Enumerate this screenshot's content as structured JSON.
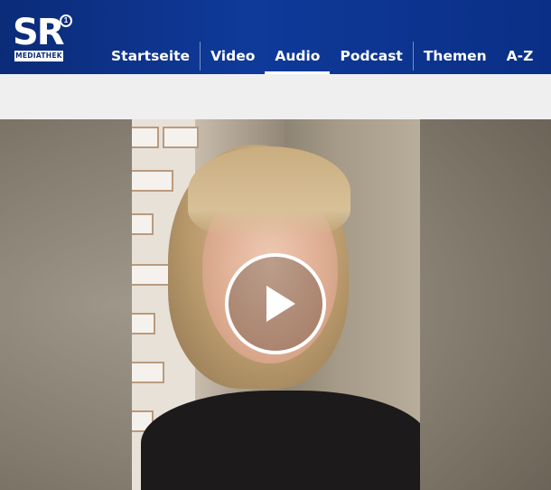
{
  "brand": {
    "logo_text": "SR",
    "logo_sub": "MEDIATHEK",
    "ard_mark": "1"
  },
  "nav": {
    "items": [
      {
        "label": "Startseite",
        "active": false
      },
      {
        "label": "Video",
        "active": false
      },
      {
        "label": "Audio",
        "active": true
      },
      {
        "label": "Podcast",
        "active": false
      },
      {
        "label": "Themen",
        "active": false
      },
      {
        "label": "A-Z",
        "active": false
      }
    ]
  },
  "player": {
    "icon": "play-icon"
  },
  "colors": {
    "header": "#0f3a9a",
    "band": "#efefef",
    "text_on_header": "#ffffff"
  }
}
